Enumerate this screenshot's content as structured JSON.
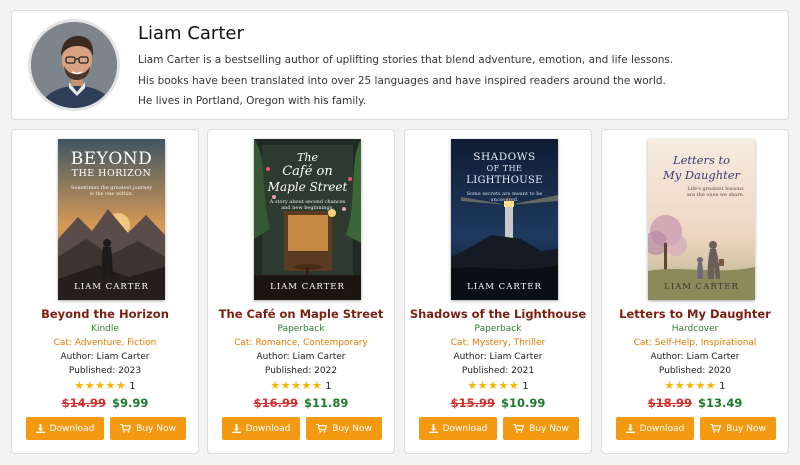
{
  "author": {
    "name": "Liam Carter",
    "bio": [
      "Liam Carter is a bestselling author of uplifting stories that blend adventure, emotion, and life lessons.",
      "His books have been translated into over 25 languages and have inspired readers around the world.",
      "He lives in Portland, Oregon with his family."
    ]
  },
  "colors": {
    "accent": "#f39a12",
    "title": "#7a1f12",
    "format": "#2e7d32",
    "category": "#e07a00",
    "old_price": "#d32f2f",
    "new_price": "#1b7a2b",
    "star": "#f6b400"
  },
  "buttons": {
    "download": "Download",
    "buy": "Buy Now",
    "download_icon": "download-icon",
    "buy_icon": "cart-icon"
  },
  "books": [
    {
      "title": "Beyond the Horizon",
      "cover_title_1": "BEYOND",
      "cover_title_2": "THE HORIZON",
      "cover_tagline": "Sometimes the greatest journey is the one within.",
      "cover_author": "LIAM CARTER",
      "format": "Kindle",
      "categories": "Cat: Adventure, Fiction",
      "author_line": "Author: Liam Carter",
      "published": "Published: 2023",
      "stars": "★★★★★",
      "rating": 5,
      "rating_count": "1",
      "old_price": "$14.99",
      "new_price": "$9.99"
    },
    {
      "title": "The Café on Maple Street",
      "cover_title_1": "The",
      "cover_title_2": "Café on",
      "cover_title_3": "Maple Street",
      "cover_tagline": "A story about second chances and new beginnings.",
      "cover_author": "LIAM CARTER",
      "format": "Paperback",
      "categories": "Cat: Romance, Contemporary",
      "author_line": "Author: Liam Carter",
      "published": "Published: 2022",
      "stars": "★★★★★",
      "rating": 5,
      "rating_count": "1",
      "old_price": "$16.99",
      "new_price": "$11.89"
    },
    {
      "title": "Shadows of the Lighthouse",
      "cover_title_1": "SHADOWS",
      "cover_title_2": "OF THE",
      "cover_title_3": "LIGHTHOUSE",
      "cover_tagline": "Some secrets are meant to be uncovered.",
      "cover_author": "LIAM CARTER",
      "format": "Paperback",
      "categories": "Cat: Mystery, Thriller",
      "author_line": "Author: Liam Carter",
      "published": "Published: 2021",
      "stars": "★★★★★",
      "rating": 5,
      "rating_count": "1",
      "old_price": "$15.99",
      "new_price": "$10.99"
    },
    {
      "title": "Letters to My Daughter",
      "cover_title_1": "Letters to",
      "cover_title_2": "My Daughter",
      "cover_tagline": "Life's greatest lessons are the ones we share.",
      "cover_author": "LIAM CARTER",
      "format": "Hardcover",
      "categories": "Cat: Self-Help, Inspirational",
      "author_line": "Author: Liam Carter",
      "published": "Published: 2020",
      "stars": "★★★★★",
      "rating": 5,
      "rating_count": "1",
      "old_price": "$18.99",
      "new_price": "$13.49"
    }
  ]
}
